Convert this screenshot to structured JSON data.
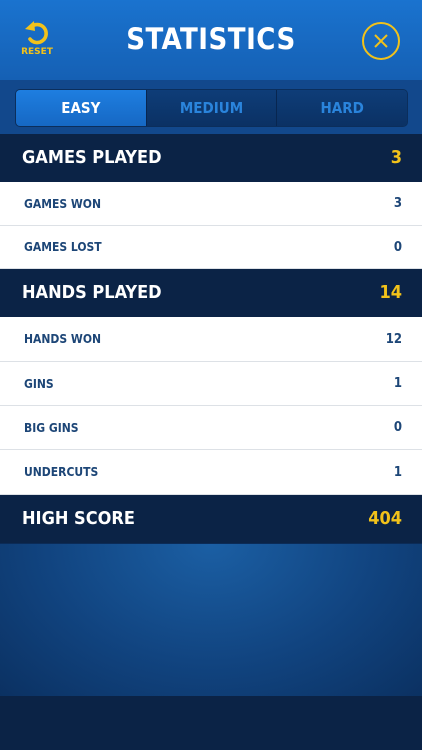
{
  "header": {
    "title": "STATISTICS",
    "reset_label": "RESET",
    "reset_icon": "reset-arrow-icon",
    "close_icon": "close-x-icon"
  },
  "tabs": [
    {
      "label": "EASY",
      "active": true
    },
    {
      "label": "MEDIUM",
      "active": false
    },
    {
      "label": "HARD",
      "active": false
    }
  ],
  "stats": {
    "games_played": {
      "label": "GAMES PLAYED",
      "value": "3"
    },
    "games_won": {
      "label": "GAMES WON",
      "value": "3"
    },
    "games_lost": {
      "label": "GAMES LOST",
      "value": "0"
    },
    "hands_played": {
      "label": "HANDS PLAYED",
      "value": "14"
    },
    "hands_won": {
      "label": "HANDS WON",
      "value": "12"
    },
    "gins": {
      "label": "GINS",
      "value": "1"
    },
    "big_gins": {
      "label": "BIG GINS",
      "value": "0"
    },
    "undercuts": {
      "label": "UNDERCUTS",
      "value": "1"
    },
    "high_score": {
      "label": "HIGH SCORE",
      "value": "404"
    }
  },
  "colors": {
    "header_blue": "#1a73cf",
    "accent_gold": "#f2c21a",
    "section_dark": "#0b2346",
    "row_text": "#1d4677"
  }
}
